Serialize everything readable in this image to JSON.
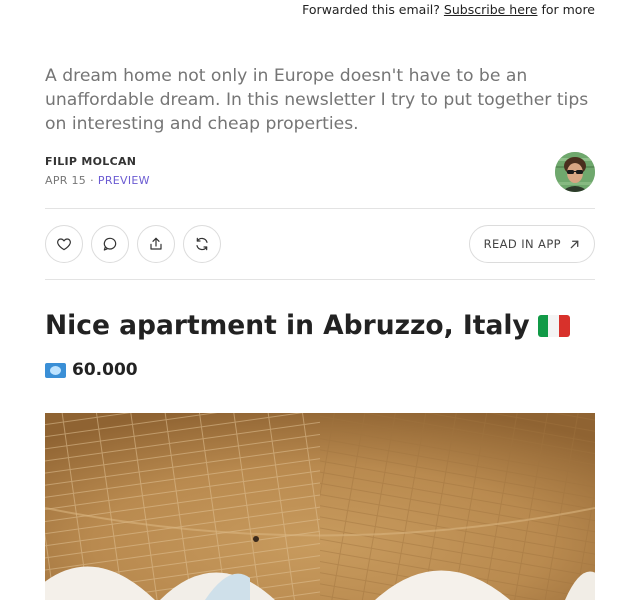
{
  "forward_bar": {
    "prefix": "Forwarded this email?",
    "link": "Subscribe here",
    "suffix": "for more"
  },
  "post": {
    "subtitle": "A dream home not only in Europe doesn't have to be an unaffordable dream. In this newsletter I try to put together tips on interesting and cheap properties.",
    "author": "FILIP MOLCAN",
    "date": "APR 15",
    "separator": "·",
    "preview_label": "PREVIEW",
    "title": "Nice apartment in Abruzzo, Italy",
    "price": "60.000"
  },
  "actions": {
    "like_icon": "heart-icon",
    "comment_icon": "comment-icon",
    "share_icon": "share-icon",
    "restack_icon": "restack-icon",
    "read_in_app_label": "READ IN APP",
    "read_in_app_icon": "arrow-up-right-icon"
  },
  "colors": {
    "preview": "#6b5bd2",
    "flag_green": "#119a47",
    "flag_white": "#ffffff",
    "flag_red": "#d8312b"
  }
}
